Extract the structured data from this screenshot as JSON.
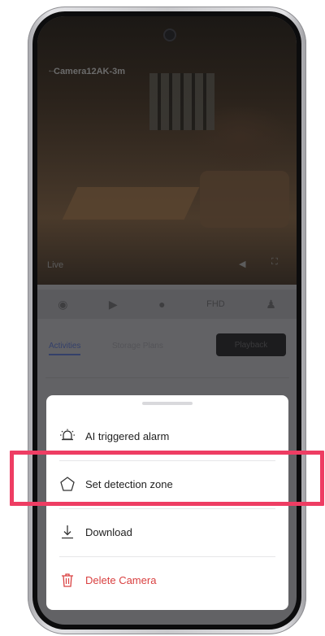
{
  "app": {
    "camera_title": "Camera12AK-3m",
    "live_badge": "Live",
    "tabs": [
      "Activities",
      "Storage Plans"
    ],
    "playback_label": "Playback",
    "quality_label": "FHD"
  },
  "sheet": {
    "items": [
      {
        "label": "AI triggered alarm",
        "icon": "alarm-bell-icon"
      },
      {
        "label": "Set detection zone",
        "icon": "pentagon-zone-icon"
      },
      {
        "label": "Download",
        "icon": "download-icon"
      },
      {
        "label": "Delete Camera",
        "icon": "trash-icon"
      }
    ]
  },
  "colors": {
    "danger": "#d94040",
    "highlight": "#ee3d63",
    "sheet_bg": "#ffffff"
  }
}
